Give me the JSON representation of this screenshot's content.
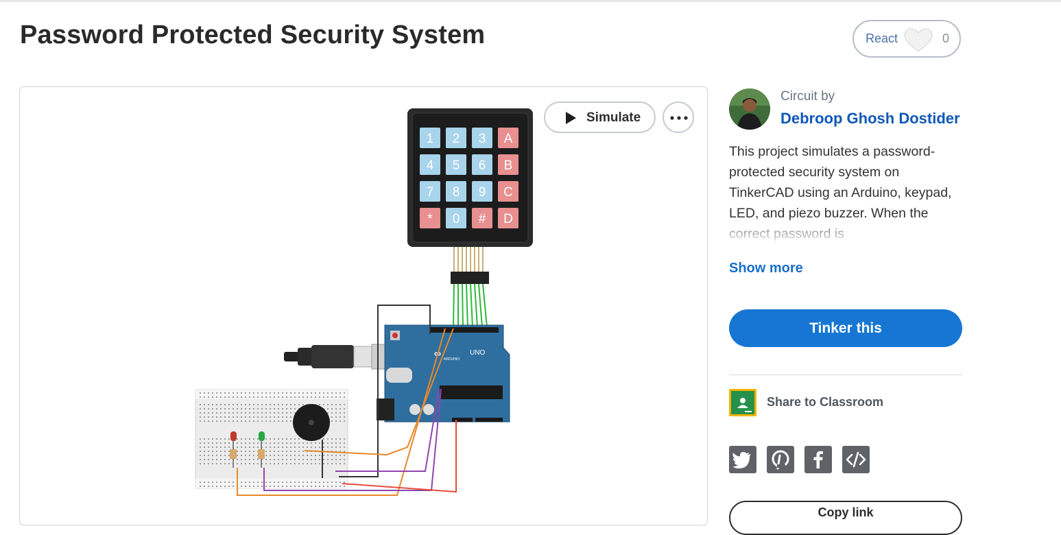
{
  "page": {
    "title": "Password Protected Security System"
  },
  "react": {
    "label": "React",
    "count": "0"
  },
  "viewer": {
    "simulate_label": "Simulate",
    "more_icon": "more-horizontal-icon",
    "keypad_keys": [
      "1",
      "2",
      "3",
      "A",
      "4",
      "5",
      "6",
      "B",
      "7",
      "8",
      "9",
      "C",
      "*",
      "0",
      "#",
      "D"
    ],
    "board_label": "UNO",
    "board_brand": "ARDUINO"
  },
  "author": {
    "prefix": "Circuit by",
    "name": "Debroop Ghosh Dostider"
  },
  "description": {
    "text": "This project simulates a password-protected security system on TinkerCAD using an Arduino, keypad, LED, and piezo buzzer. When the correct password is",
    "show_more": "Show more"
  },
  "actions": {
    "tinker_label": "Tinker this",
    "classroom_label": "Share to Classroom",
    "copy_label": "Copy link"
  },
  "social": [
    "twitter-icon",
    "pinterest-icon",
    "facebook-icon",
    "embed-code-icon"
  ],
  "colors": {
    "primary": "#1776d3",
    "author_link": "#1058b8",
    "social_bg": "#5f6368",
    "keypad_blue": "#a8d4ec",
    "keypad_red": "#e88f8f"
  }
}
